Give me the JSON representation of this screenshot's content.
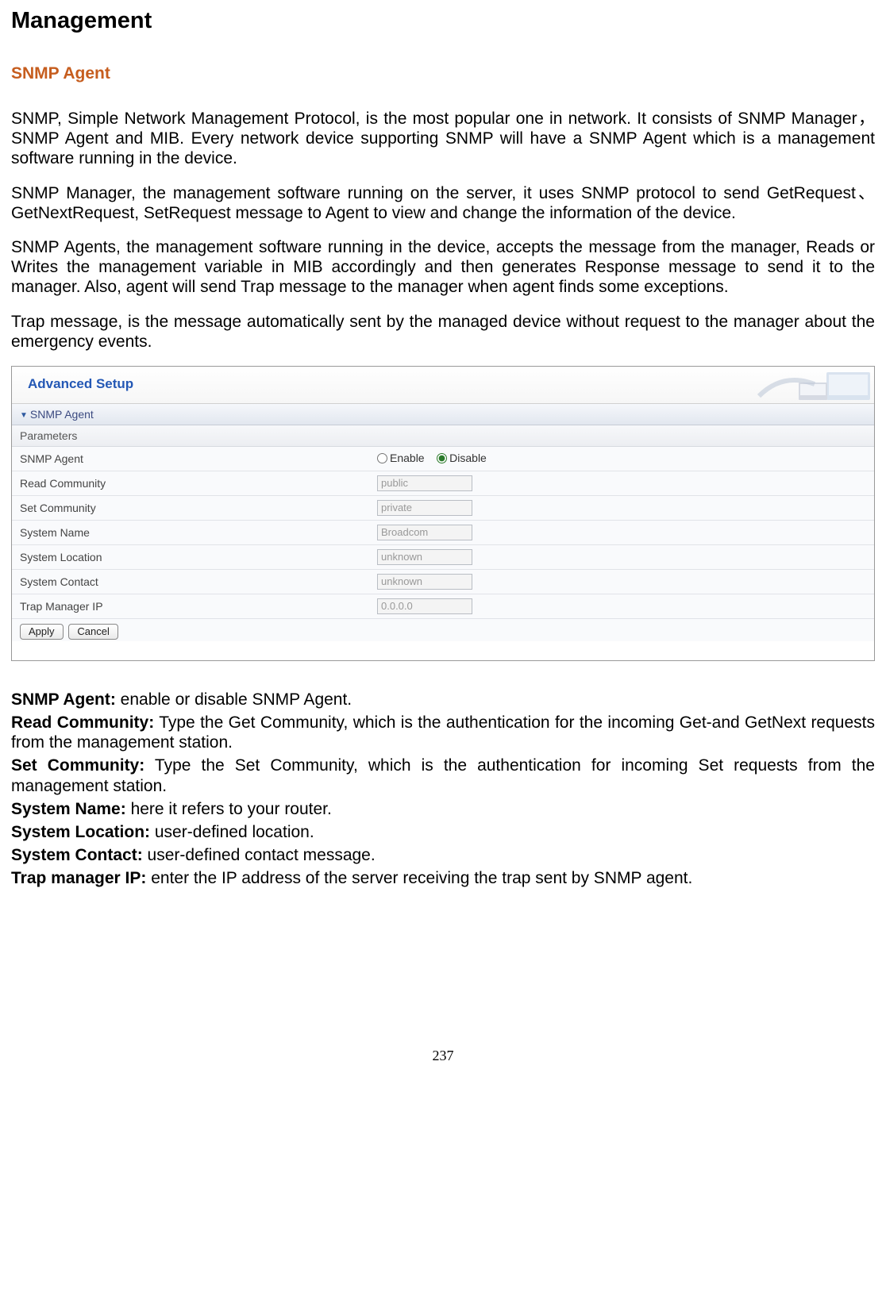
{
  "title": "Management",
  "section_title": "SNMP Agent",
  "paragraphs": {
    "p1": "SNMP, Simple Network Management Protocol, is the most popular one in network. It consists of SNMP Manager，SNMP Agent and MIB. Every network device supporting SNMP will have a SNMP Agent which is a management software running in the device.",
    "p2": "SNMP Manager, the management software running on the server, it uses SNMP protocol to send GetRequest、GetNextRequest, SetRequest message to Agent to view and change the information of the device.",
    "p3": "SNMP Agents, the management software running in the device, accepts the message from the manager, Reads or Writes the management variable in MIB accordingly and then generates Response message to send it to the manager. Also, agent will send Trap message to the manager when agent finds some exceptions.",
    "p4": "Trap message, is the message automatically sent by the managed device without request to the manager about the emergency events."
  },
  "screenshot": {
    "header": "Advanced Setup",
    "accordion": "SNMP Agent",
    "subheader": "Parameters",
    "rows": {
      "snmp_agent": {
        "label": "SNMP Agent",
        "enable": "Enable",
        "disable": "Disable",
        "selected": "disable"
      },
      "read_community": {
        "label": "Read Community",
        "value": "public"
      },
      "set_community": {
        "label": "Set Community",
        "value": "private"
      },
      "system_name": {
        "label": "System Name",
        "value": "Broadcom"
      },
      "system_location": {
        "label": "System Location",
        "value": "unknown"
      },
      "system_contact": {
        "label": "System Contact",
        "value": "unknown"
      },
      "trap_manager_ip": {
        "label": "Trap Manager IP",
        "value": "0.0.0.0"
      }
    },
    "buttons": {
      "apply": "Apply",
      "cancel": "Cancel"
    }
  },
  "definitions": {
    "snmp_agent": {
      "label": "SNMP Agent:",
      "text": " enable or disable SNMP Agent."
    },
    "read_community": {
      "label": "Read Community:",
      "text": " Type the Get Community, which is the authentication for the incoming Get-and GetNext requests from the management station."
    },
    "set_community": {
      "label": "Set Community:",
      "text": " Type the Set Community, which is the authentication for incoming Set requests from the management station."
    },
    "system_name": {
      "label": "System Name:",
      "text": " here it refers to your router."
    },
    "system_location": {
      "label": "System Location:",
      "text": " user-defined location."
    },
    "system_contact": {
      "label": "System Contact:",
      "text": " user-defined contact message."
    },
    "trap_manager_ip": {
      "label": "Trap manager IP:",
      "text": " enter the IP address of the server receiving the trap sent by SNMP agent."
    }
  },
  "page_number": "237"
}
